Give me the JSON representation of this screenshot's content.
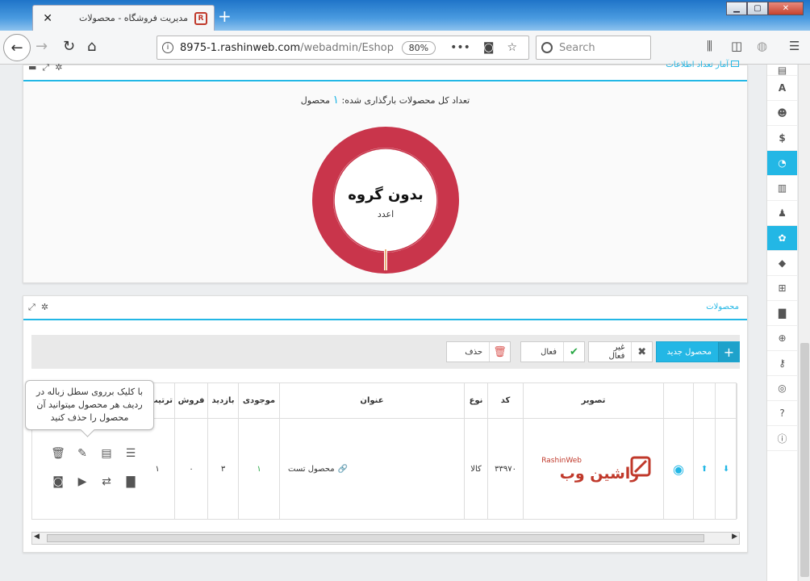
{
  "browser": {
    "tab_title": "مدیریت فروشگاه - محصولات",
    "tab_logo": "R",
    "url_host": "8975-1.rashinweb.com",
    "url_path": "/webadmin/Eshop",
    "zoom": "80%",
    "search_placeholder": "Search",
    "colors": {
      "accent": "#23b7e5",
      "danger": "#c9354b"
    }
  },
  "stats_panel": {
    "title": "آمار تعداد اطلاعات",
    "summary_prefix": "تعداد کل محصولات بارگذاری شده:",
    "summary_count": "۱",
    "summary_suffix": "محصول",
    "donut_label": "بدون گروه",
    "donut_sub": "اعدد"
  },
  "chart_data": {
    "type": "pie",
    "categories": [
      "بدون گروه"
    ],
    "values": [
      1
    ],
    "colors": [
      "#c9354b"
    ]
  },
  "products_panel": {
    "title": "محصولات",
    "buttons": {
      "new": "محصول جدید",
      "inactive": "غیر فعال",
      "active": "فعال",
      "delete": "حذف"
    },
    "columns": [
      "تصویر",
      "کد",
      "نوع",
      "عنوان",
      "موجودی",
      "بازدید",
      "فروش",
      "ترتیب"
    ],
    "row": {
      "code": "۳۳۹۷۰",
      "type": "کالا",
      "title": "محصول تست",
      "stock": "۱",
      "views": "۳",
      "sales": "۰",
      "order": "۱"
    },
    "logo_text": "راشین وب",
    "logo_en": "RashinWeb",
    "tooltip": "با کلیک برروی سطل زباله در ردیف هر محصول میتوانید آن محصول را حذف کنید"
  }
}
